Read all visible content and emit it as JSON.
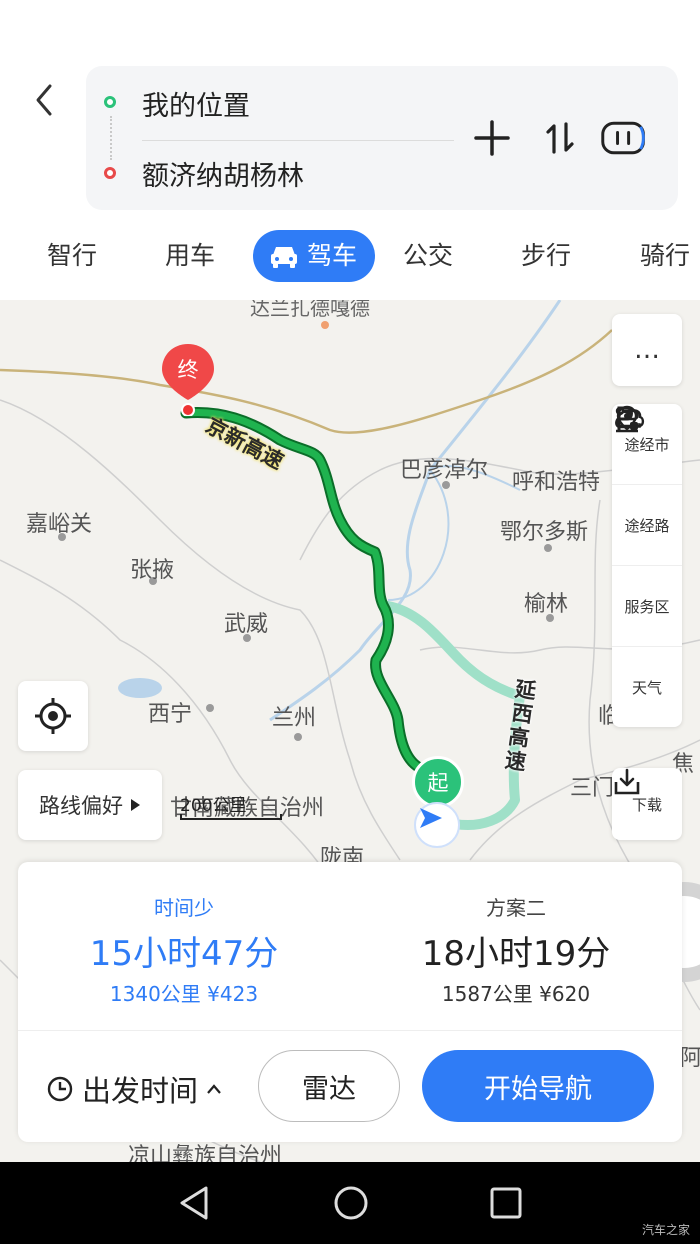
{
  "header": {
    "origin": "我的位置",
    "destination": "额济纳胡杨林"
  },
  "modes": [
    "智行",
    "用车",
    "驾车",
    "公交",
    "步行",
    "骑行"
  ],
  "active_mode": "驾车",
  "map": {
    "places": [
      "达兰扎德嘎德",
      "巴彦淖尔",
      "呼和浩特",
      "嘉峪关",
      "张掖",
      "鄂尔多斯",
      "武威",
      "榆林",
      "西宁",
      "兰州",
      "甘南藏族自治州",
      "陇南",
      "凉山彝族自治州",
      "焦",
      "三门",
      "临",
      "阿"
    ],
    "road_labels": [
      "京新高速",
      "延西高速"
    ],
    "end_marker": "终",
    "start_marker": "起",
    "scale": "200公里",
    "route_colors": {
      "primary": "#1ba84a",
      "alternative": "#9fe0c8",
      "accent": "#2f7cf6"
    }
  },
  "side_tools": {
    "more": "…",
    "items": [
      "途经市",
      "途经路",
      "服务区",
      "天气"
    ],
    "download": "下载"
  },
  "buttons": {
    "route_pref": "路线偏好",
    "depart_time": "出发时间",
    "radar": "雷达",
    "start_nav": "开始导航"
  },
  "plans": [
    {
      "tag": "时间少",
      "time": "15小时47分",
      "distance": "1340公里",
      "cost": "¥423",
      "selected": true
    },
    {
      "tag": "方案二",
      "time": "18小时19分",
      "distance": "1587公里",
      "cost": "¥620",
      "selected": false
    }
  ],
  "watermark": "汽车之家"
}
